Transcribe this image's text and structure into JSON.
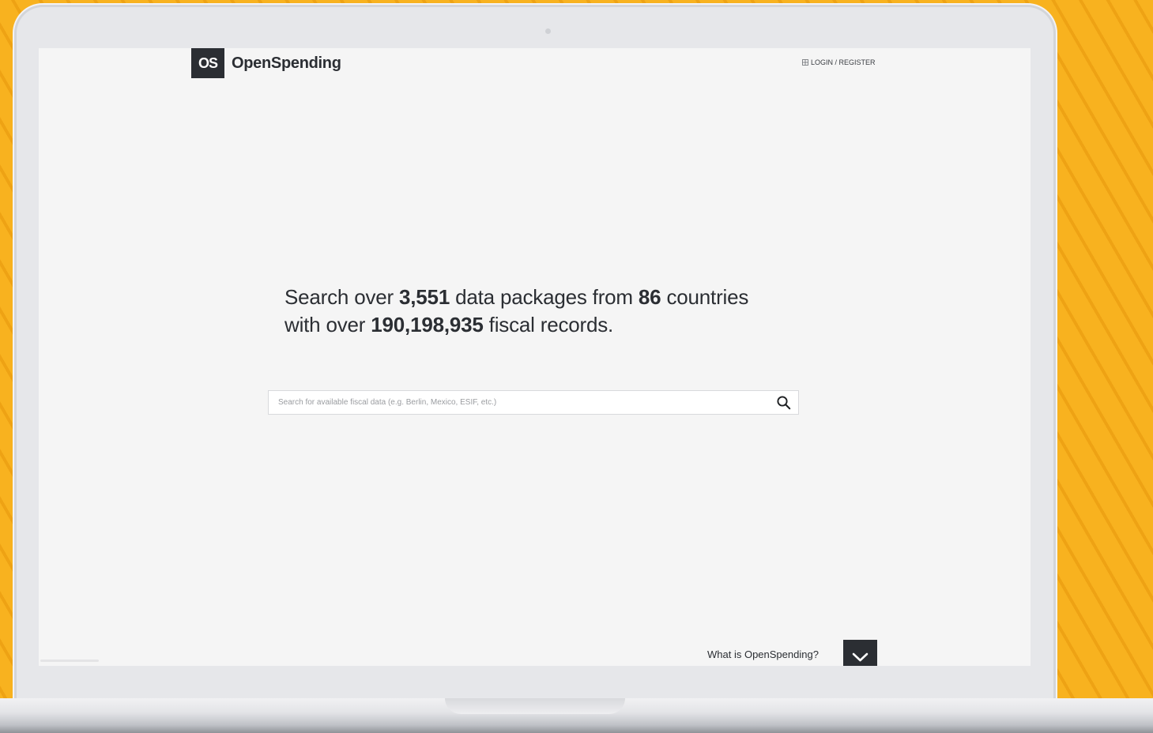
{
  "header": {
    "logo_mark": "OS",
    "logo_text": "OpenSpending",
    "login_label": "LOGIN / REGISTER",
    "login_icon": "login-icon"
  },
  "hero": {
    "line1_prefix": "Search over ",
    "packages_count": "3,551",
    "line1_middle": " data packages from ",
    "countries_count": "86",
    "line1_suffix": " countries",
    "line2_prefix": "with over ",
    "records_count": "190,198,935",
    "line2_suffix": " fiscal records."
  },
  "search": {
    "placeholder": "Search for available fiscal data (e.g. Berlin, Mexico, ESIF, etc.)",
    "value": "",
    "icon": "search-icon"
  },
  "footer": {
    "what_is_label": "What is OpenSpending?",
    "expand_icon": "chevron-down-icon"
  },
  "colors": {
    "background": "#f8b21f",
    "screen": "#f5f5f5",
    "brand_dark": "#2b2e33"
  }
}
